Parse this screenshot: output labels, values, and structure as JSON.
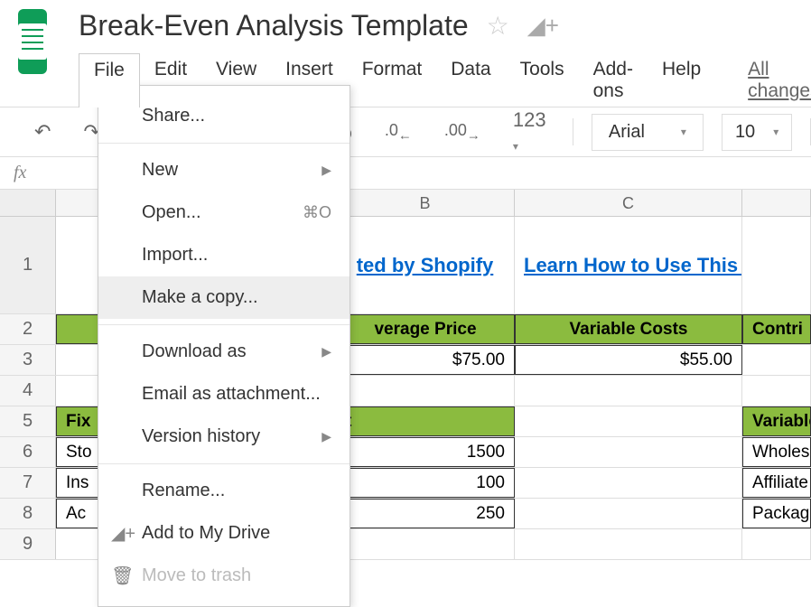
{
  "document": {
    "title": "Break-Even Analysis Template"
  },
  "menubar": {
    "items": [
      "File",
      "Edit",
      "View",
      "Insert",
      "Format",
      "Data",
      "Tools",
      "Add-ons",
      "Help"
    ],
    "all_changes": "All changes"
  },
  "toolbar": {
    "percent": "%",
    "dec_decrease": ".0",
    "dec_increase": ".00",
    "format_123": "123",
    "font": "Arial",
    "font_size": "10"
  },
  "formula_bar": {
    "fx": "fx"
  },
  "columns": [
    "B",
    "C"
  ],
  "rows": {
    "row1": {
      "num": "1",
      "b_link": "ted by Shopify",
      "c_link": "Learn How to Use This Sp"
    },
    "row2": {
      "num": "2",
      "b_header": "verage Price",
      "c_header": "Variable Costs",
      "d_header": "Contri"
    },
    "row3": {
      "num": "3",
      "b_value": "$75.00",
      "c_value": "$55.00"
    },
    "row4": {
      "num": "4"
    },
    "row5": {
      "num": "5",
      "a_header": "Fix",
      "b_header": "t",
      "d_header": "Variable"
    },
    "row6": {
      "num": "6",
      "a_value": "Sto",
      "b_value": "1500",
      "d_value": "Wholesa"
    },
    "row7": {
      "num": "7",
      "a_value": "Ins",
      "b_value": "100",
      "d_value": "Affiliate"
    },
    "row8": {
      "num": "8",
      "a_value": "Ac",
      "b_value": "250",
      "d_value": "Packagi"
    },
    "row9": {
      "num": "9"
    }
  },
  "file_menu": {
    "share": "Share...",
    "new": "New",
    "open": "Open...",
    "open_shortcut": "⌘O",
    "import": "Import...",
    "make_copy": "Make a copy...",
    "download_as": "Download as",
    "email_attachment": "Email as attachment...",
    "version_history": "Version history",
    "rename": "Rename...",
    "add_to_drive": "Add to My Drive",
    "move_to_trash": "Move to trash"
  }
}
